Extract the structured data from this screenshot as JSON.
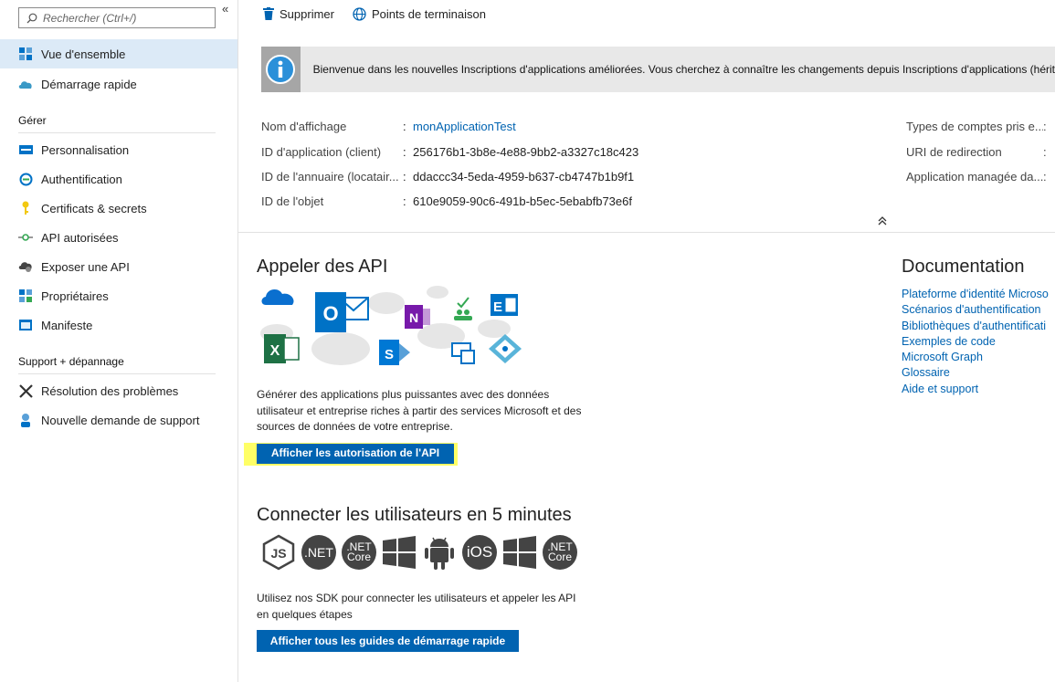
{
  "sidebar": {
    "search_placeholder": "Rechercher (Ctrl+/)",
    "collapse": "«",
    "items_top": [
      {
        "label": "Vue d'ensemble",
        "icon": "overview-grid-icon",
        "active": true
      },
      {
        "label": "Démarrage rapide",
        "icon": "cloud-rocket-icon"
      }
    ],
    "section_manage": "Gérer",
    "items_manage": [
      {
        "label": "Personnalisation",
        "icon": "branding-icon"
      },
      {
        "label": "Authentification",
        "icon": "authentication-icon"
      },
      {
        "label": "Certificats & secrets",
        "icon": "key-icon"
      },
      {
        "label": "API autorisées",
        "icon": "api-permissions-icon"
      },
      {
        "label": "Exposer une API",
        "icon": "cloud-gear-icon"
      },
      {
        "label": "Propriétaires",
        "icon": "owners-grid-icon"
      },
      {
        "label": "Manifeste",
        "icon": "manifest-icon"
      }
    ],
    "section_support": "Support + dépannage",
    "items_support": [
      {
        "label": "Résolution des problèmes",
        "icon": "wrench-icon"
      },
      {
        "label": "Nouvelle demande de support",
        "icon": "support-person-icon"
      }
    ]
  },
  "toolbar": {
    "delete_label": "Supprimer",
    "endpoints_label": "Points de terminaison"
  },
  "banner": {
    "text": "Bienvenue dans les nouvelles Inscriptions d'applications améliorées. Vous cherchez à connaître les changements depuis Inscriptions d'applications (hérit"
  },
  "properties": {
    "left": [
      {
        "key": "Nom d'affichage",
        "value": "monApplicationTest",
        "link": true
      },
      {
        "key": "ID d'application (client)",
        "value": "256176b1-3b8e-4e88-9bb2-a3327c18c423"
      },
      {
        "key": "ID de l'annuaire (locatair...",
        "value": "ddaccc34-5eda-4959-b637-cb4747b1b9f1"
      },
      {
        "key": "ID de l'objet",
        "value": "610e9059-90c6-491b-b5ec-5ebabfb73e6f"
      }
    ],
    "right": [
      {
        "key": "Types de comptes pris e..."
      },
      {
        "key": "URI de redirection"
      },
      {
        "key": "Application managée da..."
      }
    ],
    "separator": ":",
    "collapse": "⌃"
  },
  "call_api": {
    "title": "Appeler des API",
    "description": "Générer des applications plus puissantes avec des données utilisateur et entreprise riches à partir des services Microsoft et des sources de données de votre entreprise.",
    "button": "Afficher les autorisation de l'API"
  },
  "documentation": {
    "title": "Documentation",
    "links": [
      "Plateforme d'identité Microso",
      "Scénarios d'authentification",
      "Bibliothèques d'authentificati",
      "Exemples de code",
      "Microsoft Graph",
      "Glossaire",
      "Aide et support"
    ]
  },
  "connect": {
    "title": "Connecter les utilisateurs en 5 minutes",
    "sdks": [
      {
        "label": "JS",
        "icon": "nodejs-icon"
      },
      {
        "label": ".NET",
        "icon": "dotnet-icon"
      },
      {
        "label": ".NET Core",
        "icon": "dotnet-core-icon"
      },
      {
        "label": "",
        "icon": "windows-icon"
      },
      {
        "label": "",
        "icon": "android-icon"
      },
      {
        "label": "iOS",
        "icon": "ios-icon"
      },
      {
        "label": "",
        "icon": "windows-icon"
      },
      {
        "label": ".NET Core",
        "icon": "dotnet-core-icon"
      }
    ],
    "description": "Utilisez nos SDK pour connecter les utilisateurs et appeler les API en quelques étapes",
    "button": "Afficher tous les guides de démarrage rapide"
  },
  "colors": {
    "accent": "#0063b1",
    "active_bg": "#dceaf7",
    "highlight": "#ffff66"
  }
}
